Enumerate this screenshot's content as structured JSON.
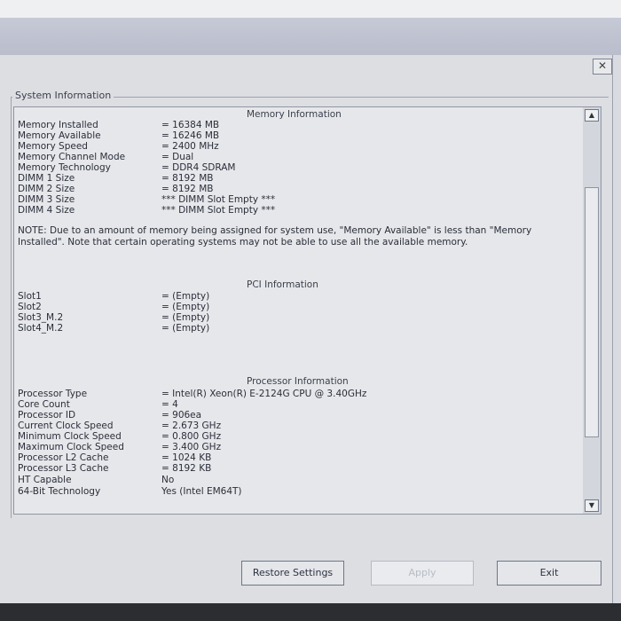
{
  "dialog": {
    "close_glyph": "✕",
    "group_label": "System Information"
  },
  "memory": {
    "title": "Memory Information",
    "rows": [
      {
        "label": "Memory Installed",
        "value": "= 16384 MB"
      },
      {
        "label": "Memory Available",
        "value": "= 16246 MB"
      },
      {
        "label": "Memory Speed",
        "value": "= 2400 MHz"
      },
      {
        "label": "Memory Channel Mode",
        "value": "= Dual"
      },
      {
        "label": "Memory Technology",
        "value": "= DDR4 SDRAM"
      },
      {
        "label": "DIMM 1 Size",
        "value": "= 8192 MB"
      },
      {
        "label": "DIMM 2 Size",
        "value": "= 8192 MB"
      },
      {
        "label": "DIMM 3 Size",
        "value": "*** DIMM Slot Empty ***"
      },
      {
        "label": "DIMM 4 Size",
        "value": "*** DIMM Slot Empty ***"
      }
    ],
    "note": "NOTE: Due to an amount of memory being assigned for system use, \"Memory Available\" is less than \"Memory Installed\". Note that certain operating systems may not be able to use all the available memory."
  },
  "pci": {
    "title": "PCI Information",
    "rows": [
      {
        "label": "Slot1",
        "value": "= (Empty)"
      },
      {
        "label": "Slot2",
        "value": "= (Empty)"
      },
      {
        "label": "Slot3_M.2",
        "value": "= (Empty)"
      },
      {
        "label": "Slot4_M.2",
        "value": "= (Empty)"
      }
    ]
  },
  "processor": {
    "title": "Processor Information",
    "rows": [
      {
        "label": "Processor Type",
        "value": "= Intel(R) Xeon(R) E-2124G CPU @ 3.40GHz"
      },
      {
        "label": "Core Count",
        "value": "= 4"
      },
      {
        "label": "Processor ID",
        "value": "= 906ea"
      },
      {
        "label": "Current Clock Speed",
        "value": "= 2.673 GHz"
      },
      {
        "label": "Minimum Clock Speed",
        "value": "= 0.800 GHz"
      },
      {
        "label": "Maximum Clock Speed",
        "value": "= 3.400 GHz"
      },
      {
        "label": "Processor L2 Cache",
        "value": "= 1024 KB"
      },
      {
        "label": "Processor L3 Cache",
        "value": "= 8192 KB"
      },
      {
        "label": "HT Capable",
        "value": "No"
      },
      {
        "label": "64-Bit Technology",
        "value": "Yes (Intel EM64T)"
      }
    ]
  },
  "scroll": {
    "up_glyph": "▲",
    "down_glyph": "▼"
  },
  "buttons": {
    "restore": "Restore Settings",
    "apply": "Apply",
    "exit": "Exit"
  }
}
